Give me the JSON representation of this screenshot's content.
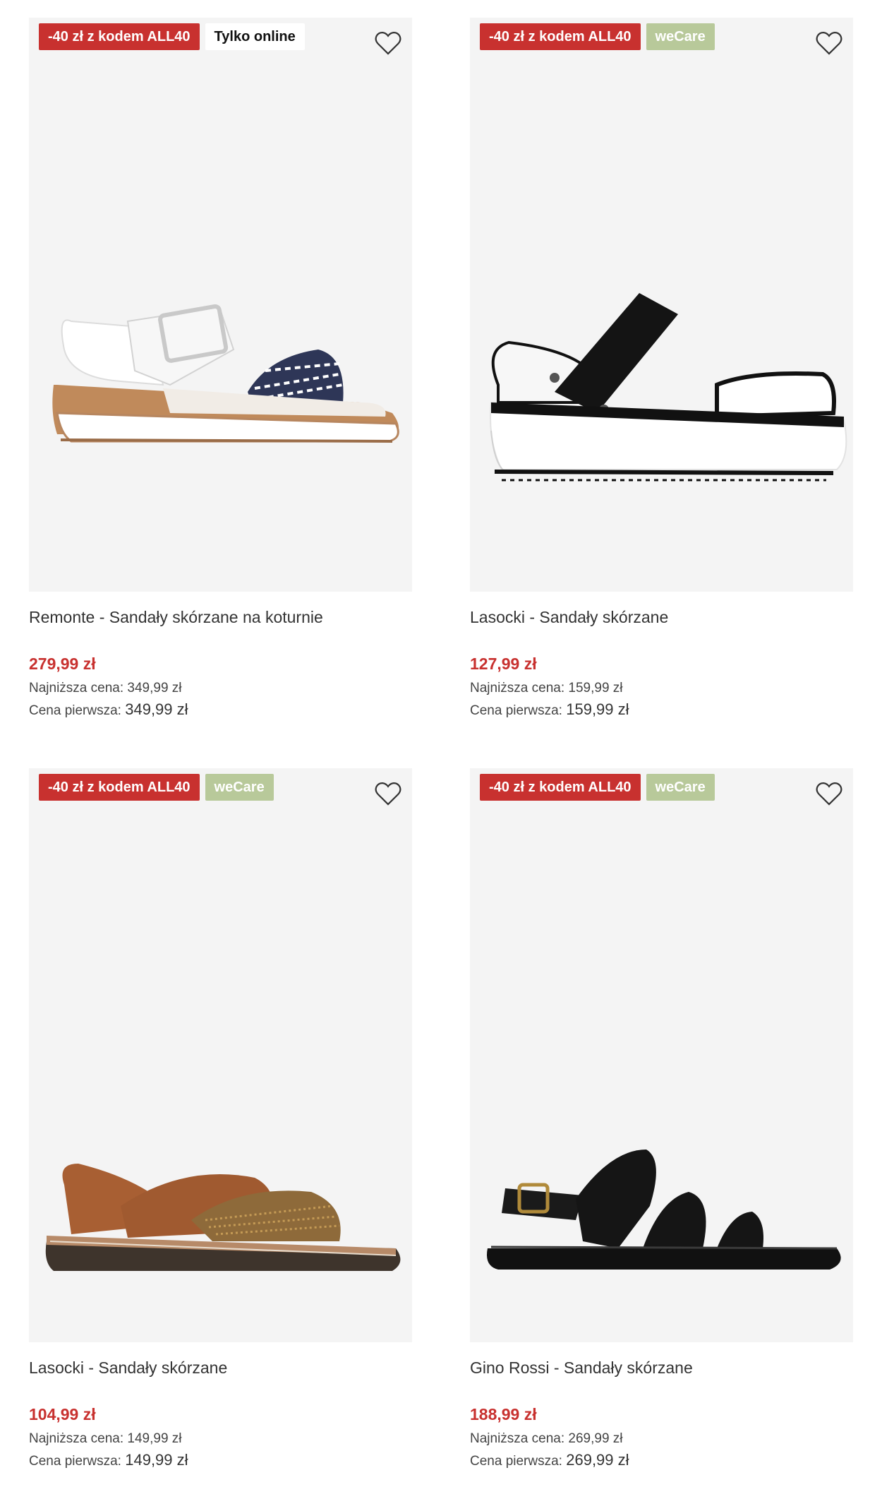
{
  "colors": {
    "promo": "#c8312f",
    "wecare": "#b8c99a",
    "price": "#c8312f",
    "card_bg": "#f4f4f4"
  },
  "products": [
    {
      "badges": [
        {
          "type": "promo",
          "text": "-40 zł z kodem ALL40"
        },
        {
          "type": "online",
          "text": "Tylko online"
        }
      ],
      "wishlist_icon": "heart-outline-icon",
      "name": "Remonte - Sandały skórzane na koturnie",
      "price": "279,99 zł",
      "lowest_label": "Najniższa cena:",
      "lowest_value": "349,99 zł",
      "original_label": "Cena pierwsza:",
      "original_value": "349,99 zł"
    },
    {
      "badges": [
        {
          "type": "promo",
          "text": "-40 zł z kodem ALL40"
        },
        {
          "type": "wecare",
          "text": "weCare"
        }
      ],
      "wishlist_icon": "heart-outline-icon",
      "name": "Lasocki - Sandały skórzane",
      "price": "127,99 zł",
      "lowest_label": "Najniższa cena:",
      "lowest_value": "159,99 zł",
      "original_label": "Cena pierwsza:",
      "original_value": "159,99 zł"
    },
    {
      "badges": [
        {
          "type": "promo",
          "text": "-40 zł z kodem ALL40"
        },
        {
          "type": "wecare",
          "text": "weCare"
        }
      ],
      "wishlist_icon": "heart-outline-icon",
      "name": "Lasocki - Sandały skórzane",
      "price": "104,99 zł",
      "lowest_label": "Najniższa cena:",
      "lowest_value": "149,99 zł",
      "original_label": "Cena pierwsza:",
      "original_value": "149,99 zł"
    },
    {
      "badges": [
        {
          "type": "promo",
          "text": "-40 zł z kodem ALL40"
        },
        {
          "type": "wecare",
          "text": "weCare"
        }
      ],
      "wishlist_icon": "heart-outline-icon",
      "name": "Gino Rossi - Sandały skórzane",
      "price": "188,99 zł",
      "lowest_label": "Najniższa cena:",
      "lowest_value": "269,99 zł",
      "original_label": "Cena pierwsza:",
      "original_value": "269,99 zł"
    }
  ]
}
